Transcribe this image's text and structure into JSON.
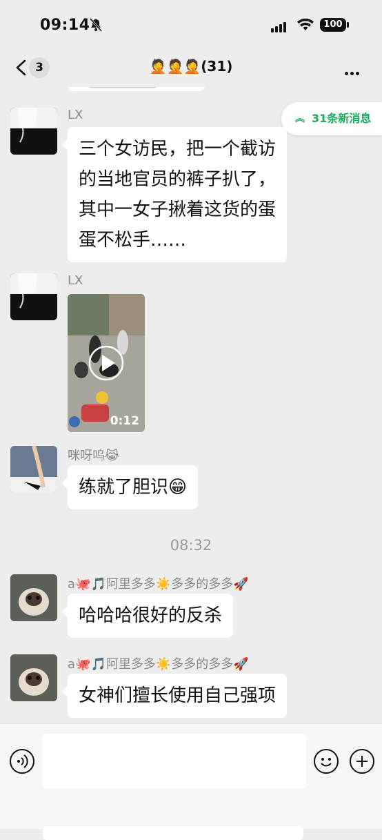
{
  "status": {
    "time": "09:14",
    "battery": "100"
  },
  "nav": {
    "back_count": "3",
    "title": "🤦🤦🤦(31)"
  },
  "new_messages": {
    "label": "31条新消息"
  },
  "messages": [
    {
      "sender": "LX",
      "text": "三个女访民，把一个截访\n的当地官员的裤子扒了，\n其中一女子揪着这货的蛋\n蛋不松手……"
    },
    {
      "sender": "LX",
      "video_duration": "0:12"
    },
    {
      "sender": "咪呀呜😹",
      "text": "练就了胆识😁"
    },
    {
      "sender": "a🐙🎵阿里多多☀️多多的多多🚀",
      "text": "哈哈哈很好的反杀"
    },
    {
      "sender": "a🐙🎵阿里多多☀️多多的多多🚀",
      "text": "女神们擅长使用自己强项"
    }
  ],
  "timestamp": "08:32",
  "input": {
    "placeholder": ""
  },
  "icons": {
    "back": "chevron-left-icon",
    "more": "more-dots-icon",
    "voice": "voice-icon",
    "emoji": "emoji-icon",
    "plus": "plus-icon"
  },
  "colors": {
    "accent": "#1aad5d",
    "background": "#ededed",
    "bubble": "#ffffff"
  }
}
